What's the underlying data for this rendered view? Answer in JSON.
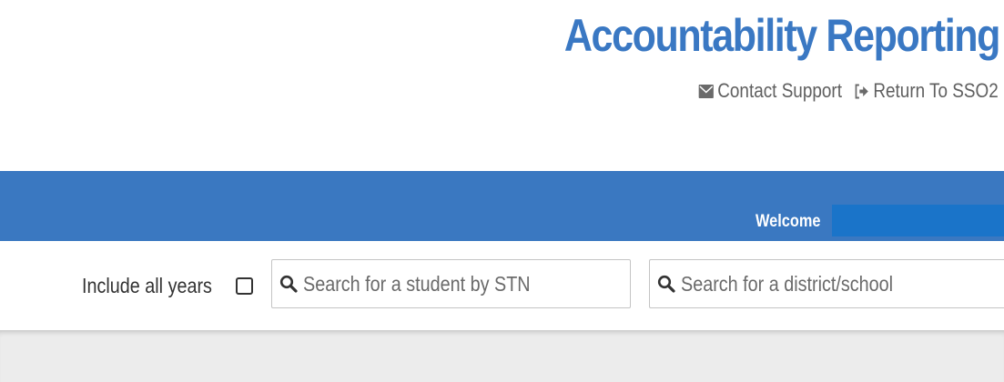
{
  "app": {
    "title": "Accountability Reporting",
    "brand_color": "#3a78c3"
  },
  "top_links": [
    {
      "label": "Contact Support",
      "icon": "envelope-icon"
    },
    {
      "label": "Return To SSO2",
      "icon": "sign-out-icon"
    }
  ],
  "navbar": {
    "color": "#3a78c1",
    "welcome_label": "Welcome"
  },
  "filters": {
    "include_all_years_label": "Include all years",
    "include_all_years_checked": false,
    "student_search_placeholder": "Search for a student by STN",
    "district_search_placeholder": "Search for a district/school"
  }
}
